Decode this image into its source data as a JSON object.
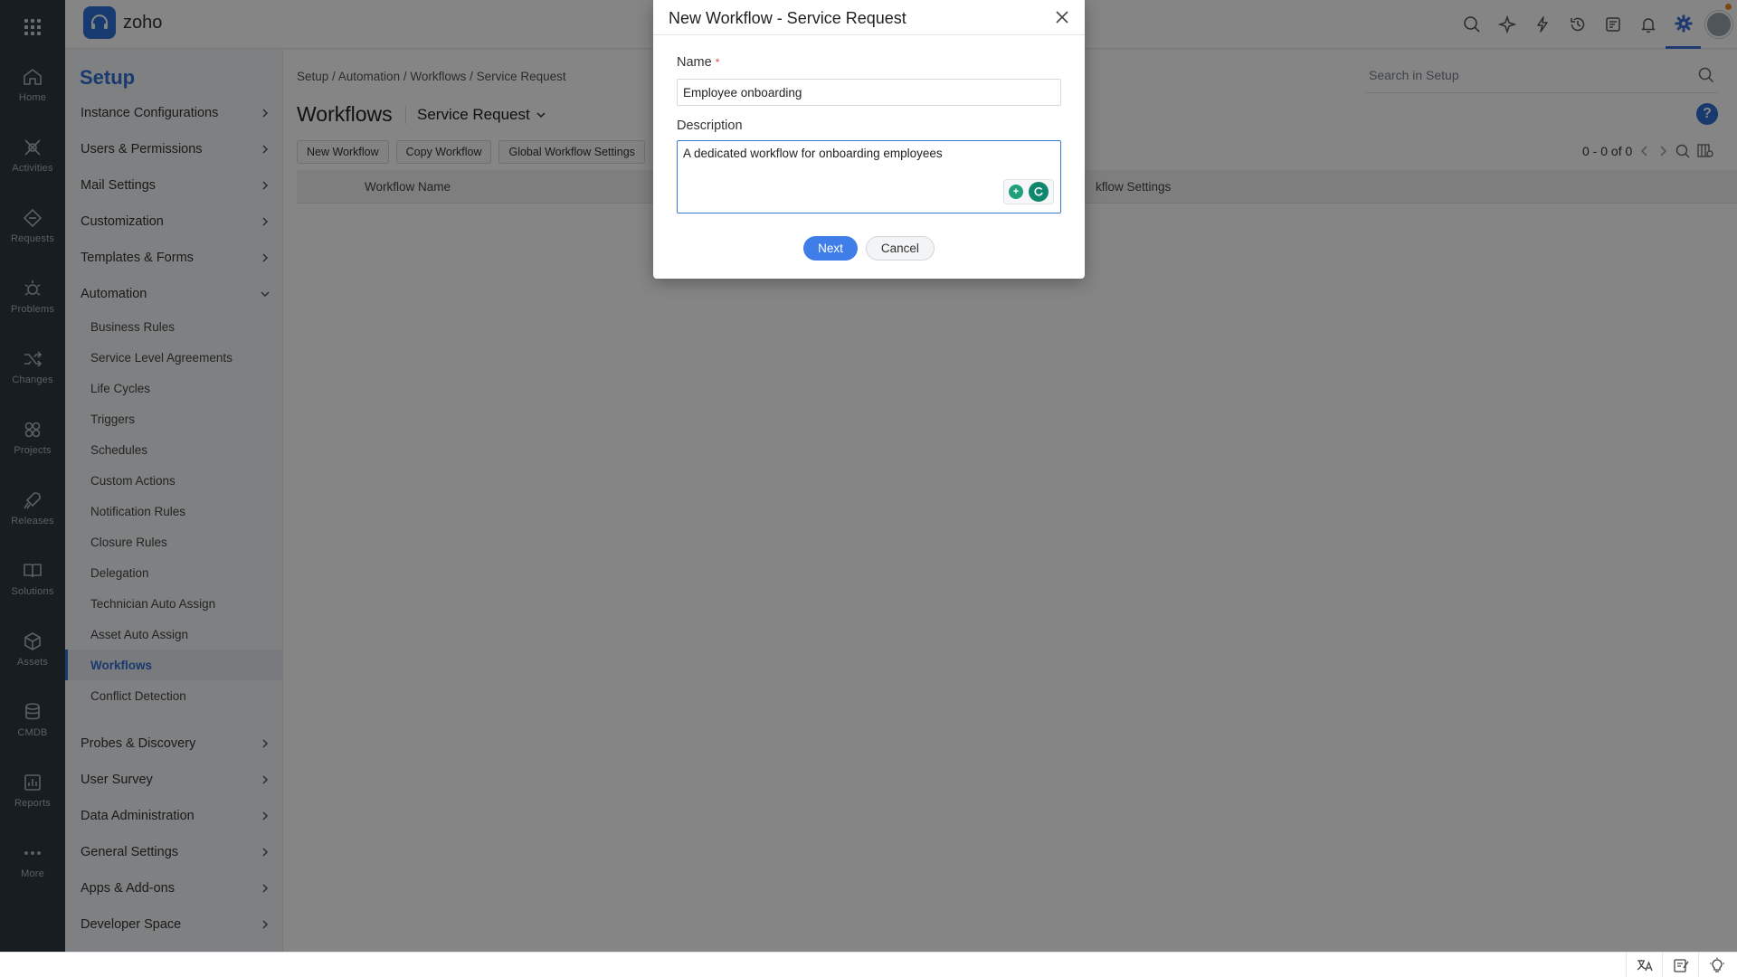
{
  "app": {
    "logo_text": "zoho"
  },
  "leftnav": {
    "items": [
      {
        "label": "Home",
        "icon": "home-icon"
      },
      {
        "label": "Activities",
        "icon": "activities-icon"
      },
      {
        "label": "Requests",
        "icon": "requests-icon"
      },
      {
        "label": "Problems",
        "icon": "problems-icon"
      },
      {
        "label": "Changes",
        "icon": "changes-icon"
      },
      {
        "label": "Projects",
        "icon": "projects-icon"
      },
      {
        "label": "Releases",
        "icon": "releases-icon"
      },
      {
        "label": "Solutions",
        "icon": "solutions-icon"
      },
      {
        "label": "Assets",
        "icon": "assets-icon"
      },
      {
        "label": "CMDB",
        "icon": "cmdb-icon"
      },
      {
        "label": "Reports",
        "icon": "reports-icon"
      },
      {
        "label": "More",
        "icon": "more-icon"
      }
    ]
  },
  "setup": {
    "title": "Setup",
    "sections_top": [
      "Instance Configurations",
      "Users & Permissions",
      "Mail Settings",
      "Customization",
      "Templates & Forms",
      "Automation"
    ],
    "automation_items": [
      "Business Rules",
      "Service Level Agreements",
      "Life Cycles",
      "Triggers",
      "Schedules",
      "Custom Actions",
      "Notification Rules",
      "Closure Rules",
      "Delegation",
      "Technician Auto Assign",
      "Asset Auto Assign",
      "Workflows",
      "Conflict Detection"
    ],
    "active_item": "Workflows",
    "sections_bottom": [
      "Probes & Discovery",
      "User Survey",
      "Data Administration",
      "General Settings",
      "Apps & Add-ons",
      "Developer Space"
    ]
  },
  "main": {
    "breadcrumb": "Setup / Automation / Workflows / Service Request",
    "search_placeholder": "Search in Setup",
    "help_label": "?",
    "page_title": "Workflows",
    "module_dropdown": "Service Request",
    "toolbar": {
      "new_workflow": "New Workflow",
      "copy_workflow": "Copy Workflow",
      "global_settings": "Global Workflow Settings"
    },
    "pager": "0 - 0 of 0",
    "columns": {
      "workflow_name": "Workflow Name",
      "settings_partial": "kflow Settings"
    }
  },
  "modal": {
    "title": "New Workflow - Service Request",
    "name_label": "Name",
    "required_mark": "*",
    "name_value": "Employee onboarding",
    "description_label": "Description",
    "description_value": "A dedicated workflow for onboarding employees",
    "next_label": "Next",
    "cancel_label": "Cancel"
  },
  "colors": {
    "accent": "#2f6fd3",
    "nav_bg": "#2e3842",
    "primary_button": "#3f7ee8"
  }
}
